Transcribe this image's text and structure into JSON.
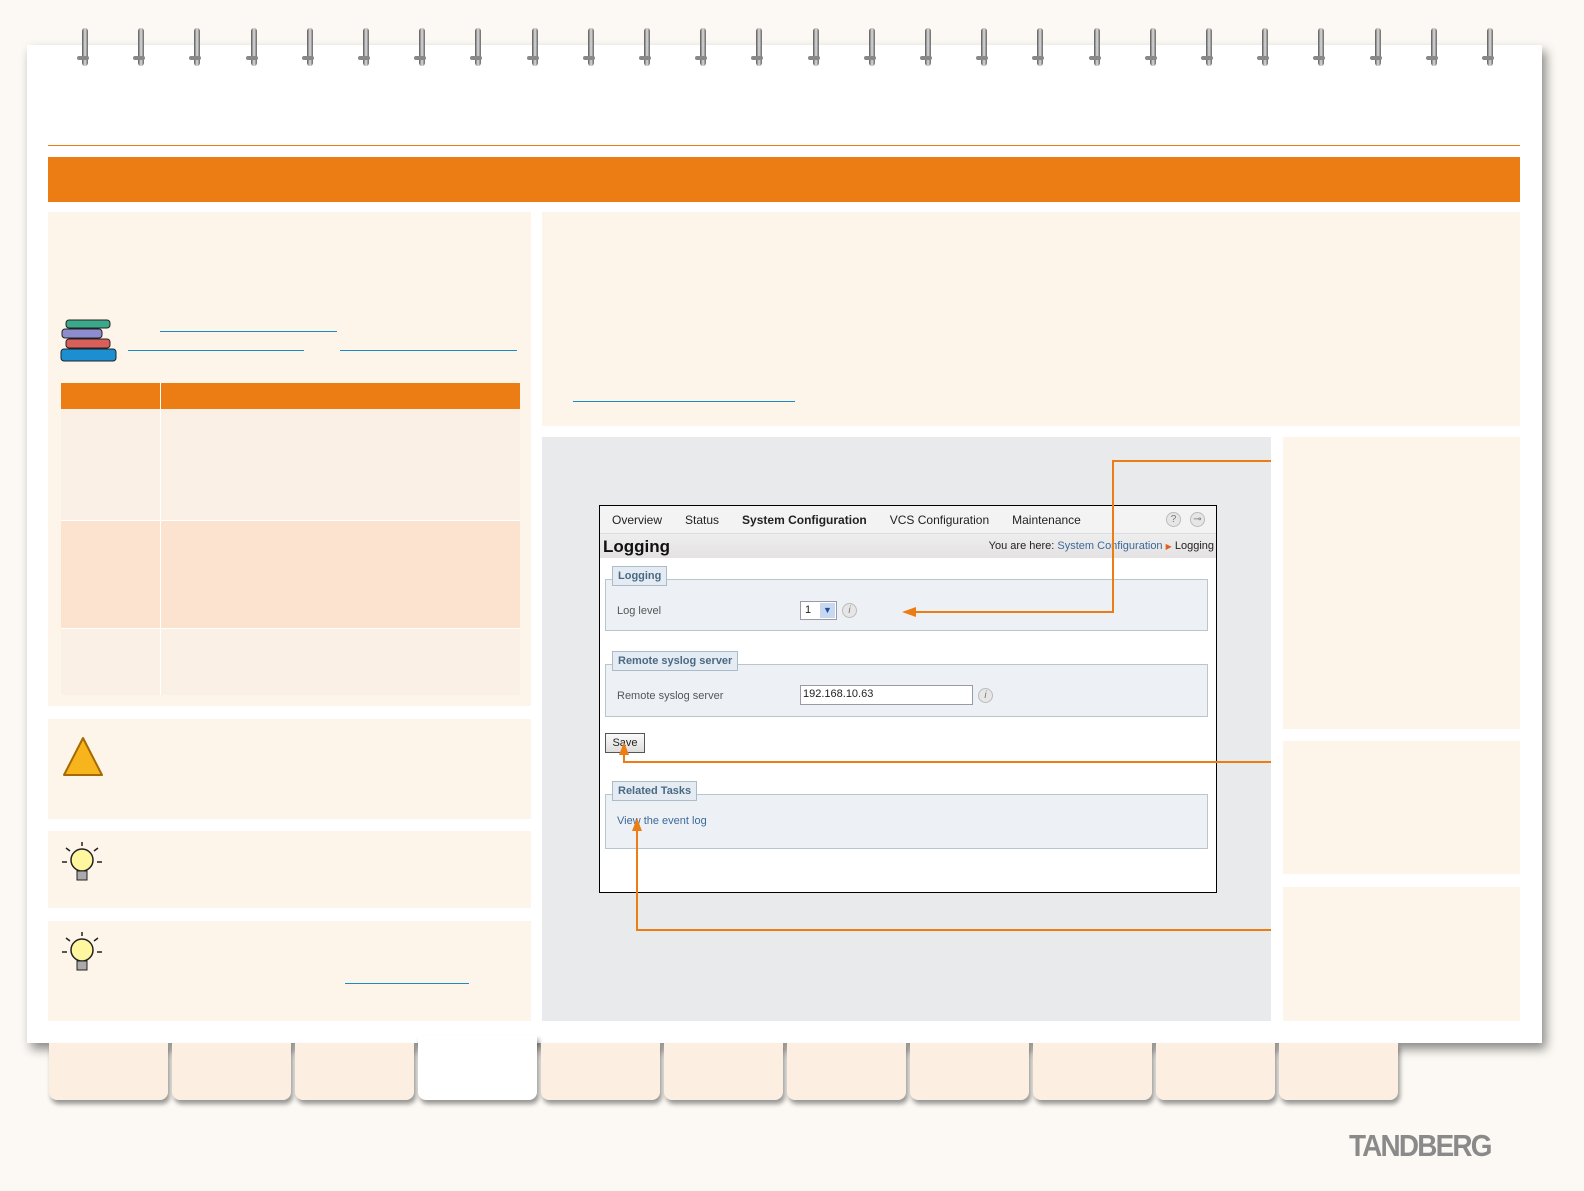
{
  "screenshot": {
    "nav": [
      "Overview",
      "Status",
      "System Configuration",
      "VCS Configuration",
      "Maintenance"
    ],
    "help_icon": "question-icon",
    "logout_icon": "key-icon",
    "page_title": "Logging",
    "breadcrumb_prefix": "You are here:",
    "breadcrumb_link": "System Configuration",
    "breadcrumb_current": "Logging",
    "logging_legend": "Logging",
    "log_level_label": "Log level",
    "log_level_value": "1",
    "syslog_legend": "Remote syslog server",
    "syslog_label": "Remote syslog server",
    "syslog_value": "192.168.10.63",
    "save_label": "Save",
    "related_legend": "Related Tasks",
    "related_link": "View the event log"
  },
  "brand": "TANDBERG",
  "colors": {
    "accent": "#ec7d14",
    "link": "#1a8ac9",
    "panel": "#fdf4ea"
  }
}
